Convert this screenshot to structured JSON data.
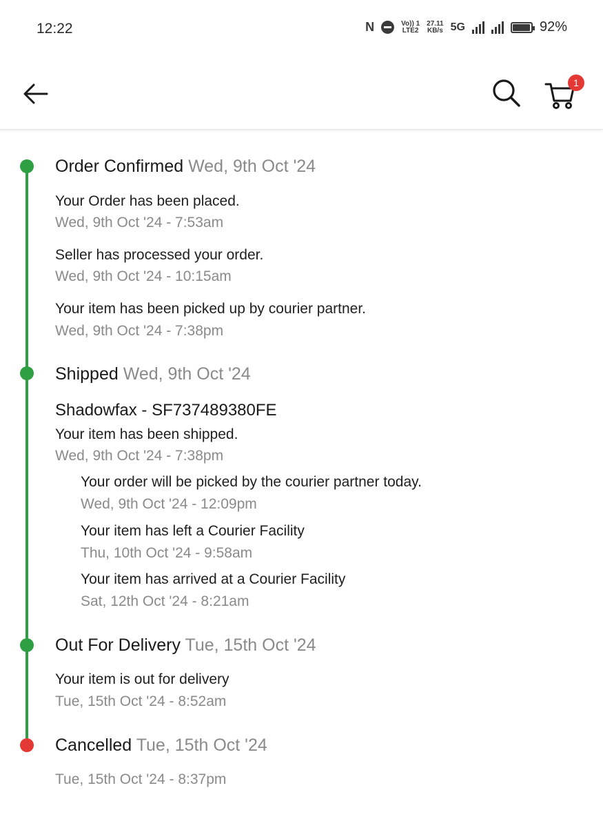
{
  "status_bar": {
    "time": "12:22",
    "nfc": "N",
    "volte_top": "Vo)) 1",
    "volte_bottom": "LTE2",
    "speed_value": "27.11",
    "speed_unit": "KB/s",
    "network": "5G",
    "battery": "92%"
  },
  "header": {
    "back_icon": "arrow-left-icon",
    "search_icon": "search-icon",
    "cart_icon": "cart-icon",
    "cart_count": "1"
  },
  "colors": {
    "done": "#2ea043",
    "cancelled": "#e53935",
    "muted_text": "#8a8a8a"
  },
  "timeline": {
    "order_confirmed": {
      "title": "Order Confirmed",
      "date": "Wed, 9th Oct '24",
      "events": [
        {
          "text": "Your Order has been placed.",
          "time": "Wed, 9th Oct '24 - 7:53am"
        },
        {
          "text": "Seller has processed your order.",
          "time": "Wed, 9th Oct '24 - 10:15am"
        },
        {
          "text": "Your item has been picked up by courier partner.",
          "time": "Wed, 9th Oct '24 - 7:38pm"
        }
      ]
    },
    "shipped": {
      "title": "Shipped",
      "date": "Wed, 9th Oct '24",
      "courier": "Shadowfax - SF737489380FE",
      "events": [
        {
          "text": "Your item has been shipped.",
          "time": "Wed, 9th Oct '24 - 7:38pm"
        }
      ],
      "sub_events": [
        {
          "text": "Your order will be picked by the courier partner today.",
          "time": "Wed, 9th Oct '24 - 12:09pm"
        },
        {
          "text": "Your item has left a Courier Facility",
          "time": "Thu, 10th Oct '24 - 9:58am"
        },
        {
          "text": "Your item has arrived at a Courier Facility",
          "time": "Sat, 12th Oct '24 - 8:21am"
        }
      ]
    },
    "out_for_delivery": {
      "title": "Out For Delivery",
      "date": "Tue, 15th Oct '24",
      "events": [
        {
          "text": "Your item is out for delivery",
          "time": "Tue, 15th Oct '24 - 8:52am"
        }
      ]
    },
    "cancelled": {
      "title": "Cancelled",
      "date": "Tue, 15th Oct '24",
      "time": "Tue, 15th Oct '24 - 8:37pm"
    }
  }
}
